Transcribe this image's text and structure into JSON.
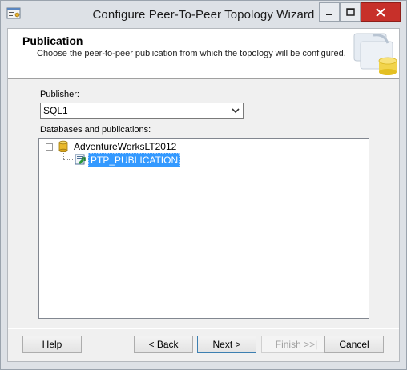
{
  "window": {
    "title": "Configure Peer-To-Peer Topology Wizard",
    "icon": "wizard-app-icon",
    "controls": [
      "minimize-icon",
      "maximize-icon",
      "close-icon"
    ]
  },
  "header": {
    "title": "Publication",
    "subtitle": "Choose the peer-to-peer publication from which the topology will be configured."
  },
  "publisher": {
    "label": "Publisher:",
    "value": "SQL1"
  },
  "databases": {
    "label": "Databases and publications:",
    "tree": [
      {
        "label": "AdventureWorksLT2012",
        "icon": "database-icon",
        "expanded": true,
        "children": [
          {
            "label": "PTP_PUBLICATION",
            "icon": "publication-icon",
            "selected": true
          }
        ]
      }
    ]
  },
  "footer": {
    "help": "Help",
    "back": "< Back",
    "next": "Next >",
    "finish": "Finish >>|",
    "cancel": "Cancel"
  },
  "colors": {
    "selection": "#3399ff",
    "close_button": "#c7302a",
    "dialog_background": "#f0f0f0"
  }
}
